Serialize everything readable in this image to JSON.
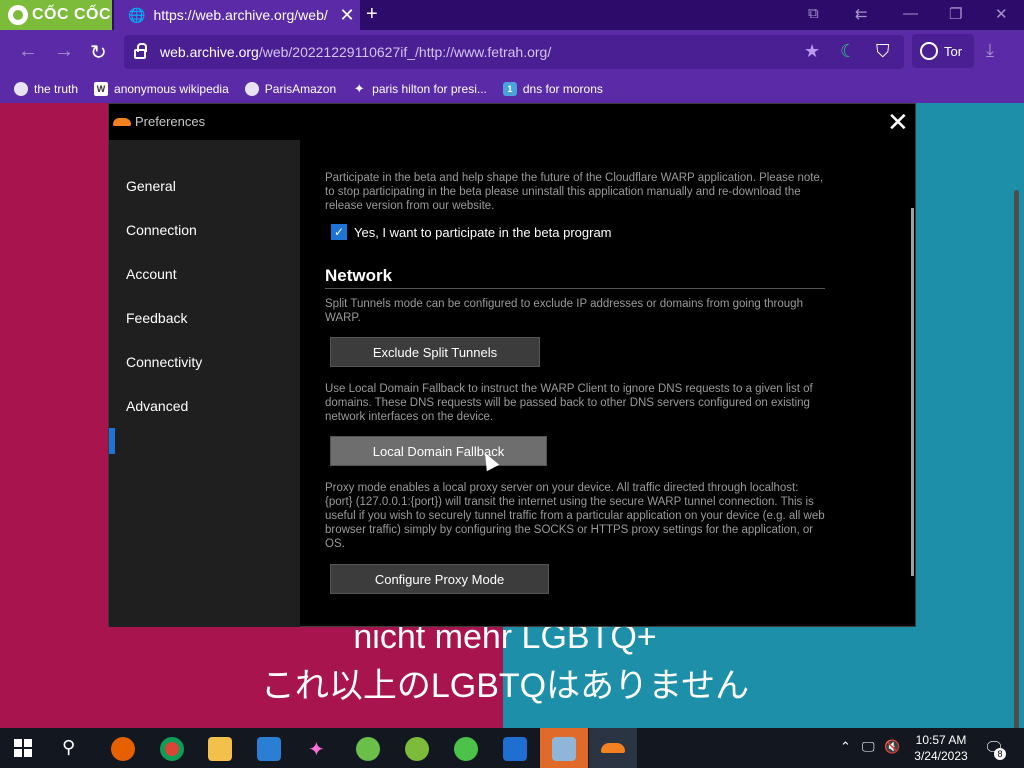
{
  "browser": {
    "brand": "CỐC CỐC",
    "tab_title": "https://web.archive.org/web/",
    "url_host": "web.archive.org",
    "url_rest": "/web/20221229110627if_/http://www.fetrah.org/",
    "tor_label": "Tor",
    "bookmarks": [
      {
        "label": "the truth"
      },
      {
        "label": "anonymous wikipedia"
      },
      {
        "label": "ParisAmazon"
      },
      {
        "label": "paris hilton for presi..."
      },
      {
        "label": "dns for morons"
      }
    ]
  },
  "page": {
    "caption_line1": "nicht mehr LGBTQ+",
    "caption_line2": "これ以上のLGBTQはありません"
  },
  "dialog": {
    "title": "Preferences",
    "sidebar": [
      {
        "label": "General"
      },
      {
        "label": "Connection"
      },
      {
        "label": "Account"
      },
      {
        "label": "Feedback"
      },
      {
        "label": "Connectivity"
      },
      {
        "label": "Advanced"
      }
    ],
    "active_item": "Advanced",
    "beta_text": "Participate in the beta and help shape the future of the Cloudflare WARP application. Please note, to stop participating in the beta please uninstall this application manually and re-download the release version from our website.",
    "beta_checkbox_label": "Yes, I want to participate in the beta program",
    "beta_checked": true,
    "network_heading": "Network",
    "split_text": "Split Tunnels mode can be configured to exclude IP addresses or domains from going through WARP.",
    "split_button": "Exclude Split Tunnels",
    "fallback_text": "Use Local Domain Fallback to instruct the WARP Client to ignore DNS requests to a given list of domains. These DNS requests will be passed back to other DNS servers configured on existing network interfaces on the device.",
    "fallback_button": "Local Domain Fallback",
    "proxy_text": "Proxy mode enables a local proxy server on your device. All traffic directed through localhost:{port} (127.0.0.1:{port}) will transit the internet using the secure WARP tunnel connection. This is useful if you wish to securely tunnel traffic from a particular application on your device (e.g. all web browser traffic) simply by configuring the SOCKS or HTTPS proxy settings for the application, or OS.",
    "proxy_button": "Configure Proxy Mode"
  },
  "taskbar": {
    "time": "10:57 AM",
    "date": "3/24/2023",
    "notification_count": "8"
  }
}
